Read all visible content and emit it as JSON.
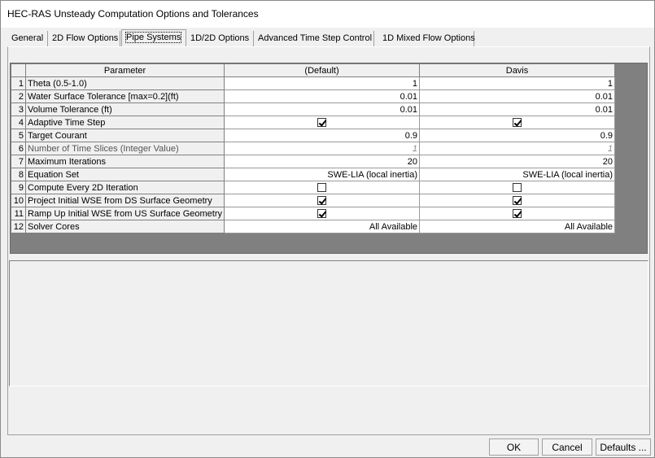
{
  "window": {
    "title": "HEC-RAS Unsteady Computation Options and Tolerances"
  },
  "tabs": [
    {
      "label": "General"
    },
    {
      "label": "2D Flow Options"
    },
    {
      "label": "Pipe Systems",
      "active": true
    },
    {
      "label": "1D/2D Options"
    },
    {
      "label": "Advanced Time Step Control"
    },
    {
      "label": "1D Mixed Flow Options"
    }
  ],
  "grid": {
    "headers": {
      "param": "Parameter",
      "col1": "(Default)",
      "col2": "Davis"
    },
    "rows": [
      {
        "n": "1",
        "param": "Theta  (0.5-1.0)",
        "col1": "1",
        "col2": "1",
        "kind": "text"
      },
      {
        "n": "2",
        "param": "Water Surface Tolerance [max=0.2](ft)",
        "col1": "0.01",
        "col2": "0.01",
        "kind": "text"
      },
      {
        "n": "3",
        "param": "Volume Tolerance (ft)",
        "col1": "0.01",
        "col2": "0.01",
        "kind": "text"
      },
      {
        "n": "4",
        "param": "Adaptive Time Step",
        "col1": true,
        "col2": true,
        "kind": "check"
      },
      {
        "n": "5",
        "param": "Target Courant",
        "col1": "0.9",
        "col2": "0.9",
        "kind": "text"
      },
      {
        "n": "6",
        "param": "Number of Time Slices (Integer Value)",
        "col1": "1",
        "col2": "1",
        "kind": "disabled"
      },
      {
        "n": "7",
        "param": "Maximum Iterations",
        "col1": "20",
        "col2": "20",
        "kind": "text"
      },
      {
        "n": "8",
        "param": "Equation Set",
        "col1": "SWE-LIA (local inertia)",
        "col2": "SWE-LIA (local inertia)",
        "kind": "text"
      },
      {
        "n": "9",
        "param": "Compute Every 2D Iteration",
        "col1": false,
        "col2": false,
        "kind": "check"
      },
      {
        "n": "10",
        "param": "Project Initial WSE from DS Surface Geometry",
        "col1": true,
        "col2": true,
        "kind": "check"
      },
      {
        "n": "11",
        "param": "Ramp Up Initial WSE from US Surface Geometry",
        "col1": true,
        "col2": true,
        "kind": "check"
      },
      {
        "n": "12",
        "param": "Solver Cores",
        "col1": "All Available",
        "col2": "All Available",
        "kind": "text"
      }
    ]
  },
  "buttons": {
    "ok": "OK",
    "cancel": "Cancel",
    "defaults": "Defaults ..."
  }
}
